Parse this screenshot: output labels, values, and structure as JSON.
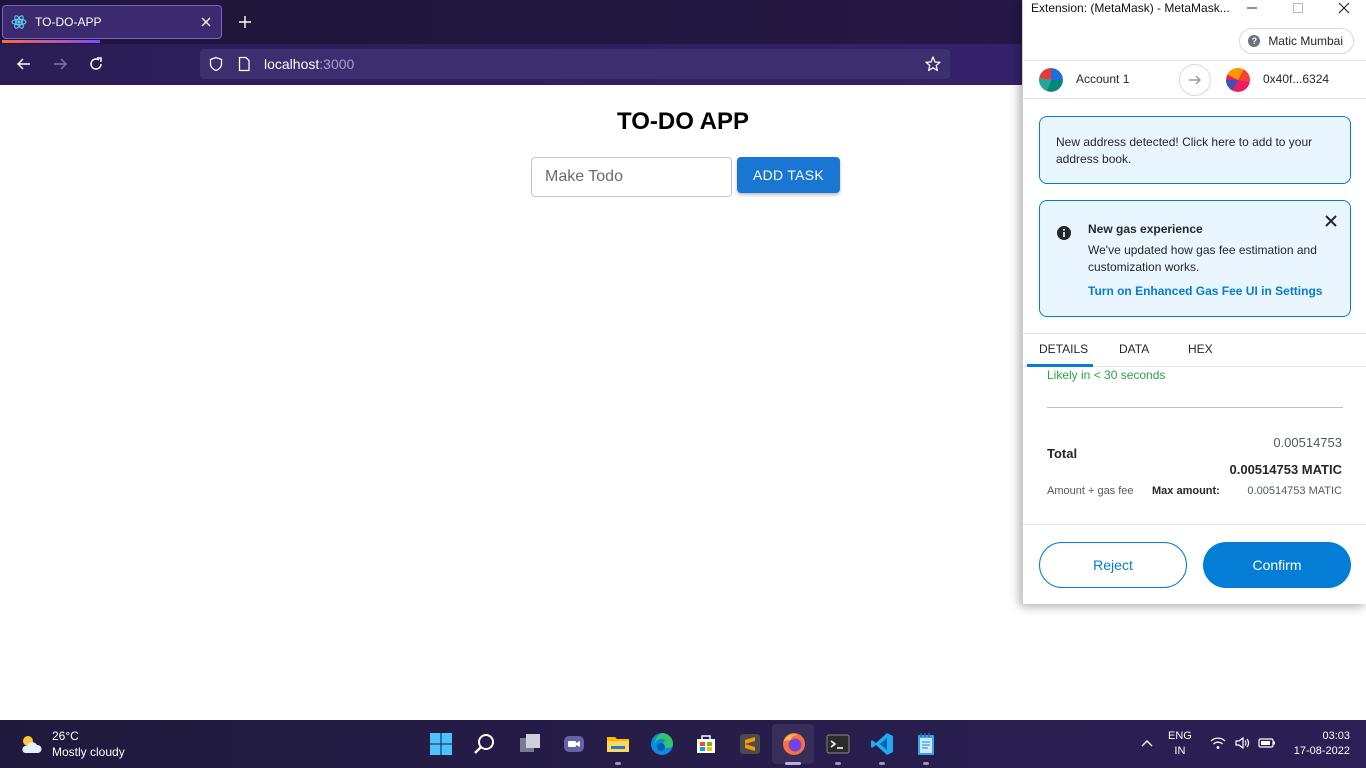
{
  "browser": {
    "tab_title": "TO-DO-APP",
    "url_host": "localhost",
    "url_port": ":3000"
  },
  "app": {
    "title": "TO-DO APP",
    "input_placeholder": "Make Todo",
    "add_button": "ADD TASK"
  },
  "metamask": {
    "window_title": "Extension: (MetaMask) - MetaMask...",
    "network": "Matic Mumbai",
    "network_help": "?",
    "from_account": "Account 1",
    "to_address": "0x40f...6324",
    "address_alert": "New address detected! Click here to add to your address book.",
    "gas_alert": {
      "title": "New gas experience",
      "body": "We've updated how gas fee estimation and customization works.",
      "link": "Turn on Enhanced Gas Fee UI in Settings"
    },
    "tabs": [
      "DETAILS",
      "DATA",
      "HEX"
    ],
    "likely_text": "Likely in < 30 seconds",
    "total_label": "Total",
    "total_secondary": "0.00514753",
    "total_primary": "0.00514753 MATIC",
    "amount_gas_label": "Amount + gas fee",
    "max_amount_label": "Max amount:",
    "max_amount_value": "0.00514753 MATIC",
    "reject": "Reject",
    "confirm": "Confirm",
    "accent_color": "#037dd6"
  },
  "taskbar": {
    "weather_temp": "26°C",
    "weather_desc": "Mostly cloudy",
    "lang_line1": "ENG",
    "lang_line2": "IN",
    "time": "03:03",
    "date": "17-08-2022",
    "apps": [
      "start-icon",
      "search-icon",
      "task-view-icon",
      "teams-chat-icon",
      "file-explorer-icon",
      "edge-icon",
      "microsoft-store-icon",
      "sublime-text-icon",
      "firefox-icon",
      "terminal-icon",
      "vscode-icon",
      "notepad-icon"
    ]
  }
}
